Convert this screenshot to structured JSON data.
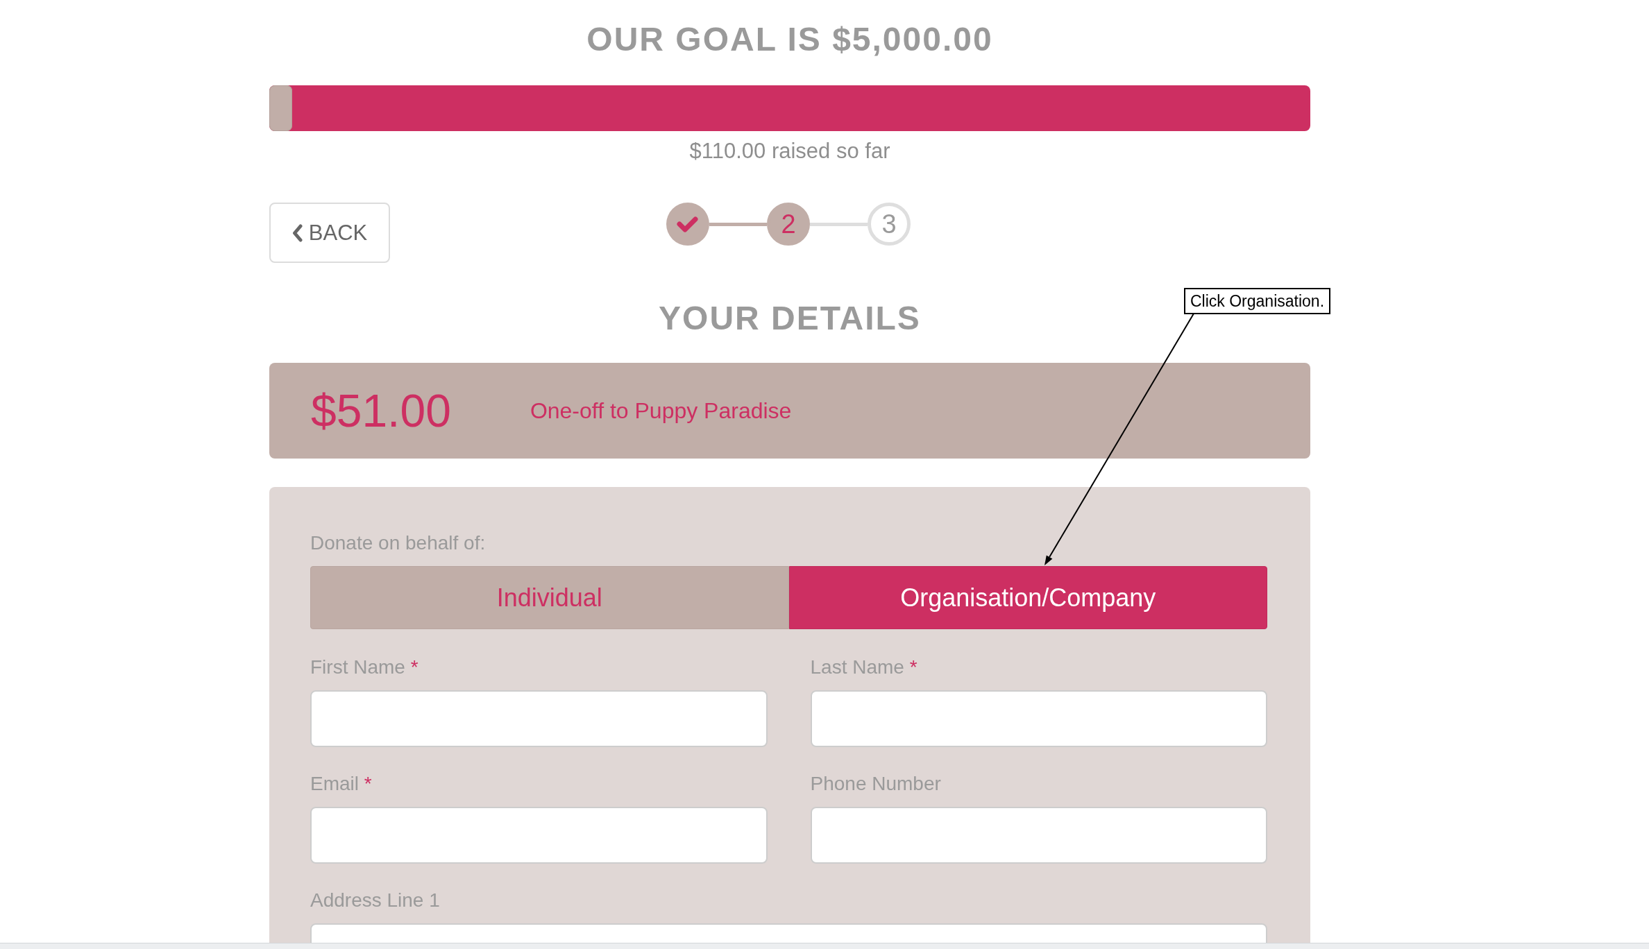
{
  "goal": {
    "title": "OUR GOAL IS $5,000.00",
    "progress": {
      "level": 0.022
    },
    "raised": "$110.00 raised so far"
  },
  "back_button": {
    "label": "BACK"
  },
  "steps": [
    {
      "completed": true,
      "selected": false
    },
    {
      "label": "2",
      "completed": false,
      "selected": true
    },
    {
      "label": "3",
      "completed": false,
      "selected": false
    }
  ],
  "section_title": "YOUR DETAILS",
  "summary": {
    "amount": "$51.00",
    "description": "One-off to Puppy Paradise"
  },
  "form": {
    "behalf_label": "Donate on behalf of:",
    "behalf_options": [
      {
        "label": "Individual",
        "selected": false
      },
      {
        "label": "Organisation/Company",
        "selected": true
      }
    ],
    "fields": [
      {
        "kind": "half",
        "label": "First Name",
        "required_mark": "*"
      },
      {
        "kind": "half",
        "label": "Last Name",
        "required_mark": "*"
      },
      {
        "kind": "half",
        "label": "Email",
        "required_mark": "*"
      },
      {
        "kind": "half",
        "label": "Phone Number"
      },
      {
        "kind": "full",
        "label": "Address Line 1"
      }
    ]
  },
  "annotation": {
    "text": "Click Organisation."
  }
}
